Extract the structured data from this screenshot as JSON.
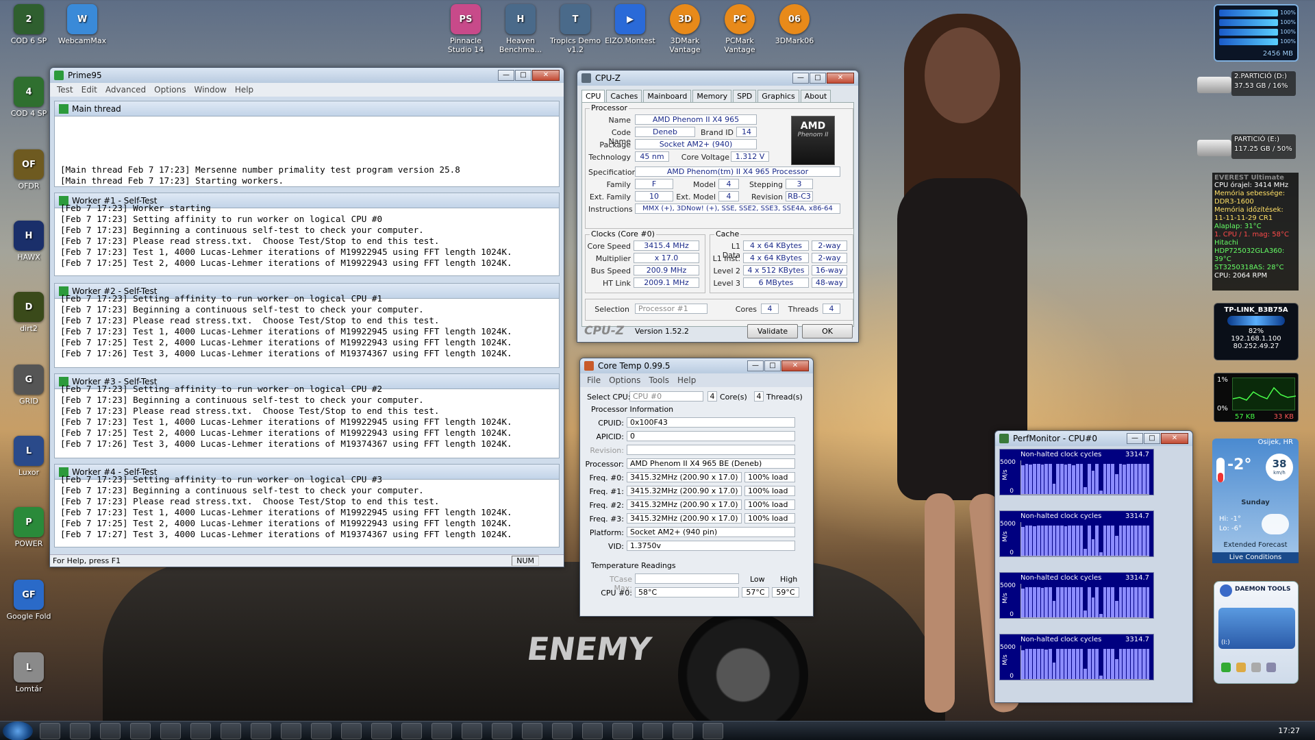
{
  "desktop_icons": [
    {
      "label": "COD 6 SP",
      "color": "#2f5f2f",
      "glyph": "2"
    },
    {
      "label": "COD 4 SP",
      "color": "#2f6f2f",
      "glyph": "4"
    },
    {
      "label": "OFDR",
      "color": "#6e5a20",
      "glyph": "OF"
    },
    {
      "label": "HAWX",
      "color": "#1a2f6a",
      "glyph": "H"
    },
    {
      "label": "dirt2",
      "color": "#3a4a1a",
      "glyph": "D"
    },
    {
      "label": "GRID",
      "color": "#555",
      "glyph": "G"
    },
    {
      "label": "Luxor",
      "color": "#2a4a8a",
      "glyph": "L"
    },
    {
      "label": "POWER",
      "color": "#2a8a3a",
      "glyph": "P"
    },
    {
      "label": "Google Fold",
      "color": "#2a6ac8",
      "glyph": "GF"
    },
    {
      "label": "Lomtár",
      "color": "#8a8a8a",
      "glyph": "L"
    }
  ],
  "top_icons": [
    {
      "label": "WebcamMax",
      "color": "#3a8ad8",
      "glyph": "W"
    },
    {
      "label": "Pinnacle Studio 14",
      "color": "#c84a8a",
      "glyph": "PS"
    },
    {
      "label": "Heaven Benchma...",
      "color": "#4a6a8a",
      "glyph": "H"
    },
    {
      "label": "Tropics Demo v1.2",
      "color": "#4a6a8a",
      "glyph": "T"
    },
    {
      "label": "EIZO.Montest",
      "color": "#2a6ad8",
      "glyph": "▶"
    },
    {
      "label": "3DMark Vantage",
      "color": "#e88a1a",
      "glyph": "3D"
    },
    {
      "label": "PCMark Vantage",
      "color": "#e88a1a",
      "glyph": "PC"
    },
    {
      "label": "3DMark06",
      "color": "#e88a1a",
      "glyph": "06"
    }
  ],
  "prime95": {
    "title": "Prime95",
    "menu": [
      "Test",
      "Edit",
      "Advanced",
      "Options",
      "Window",
      "Help"
    ],
    "panes": [
      {
        "title": "Main thread",
        "lines": [
          "[Main thread Feb 7 17:23] Mersenne number primality test program version 25.8",
          "[Main thread Feb 7 17:23] Starting workers."
        ]
      },
      {
        "title": "Worker #1 - Self-Test",
        "lines": [
          "[Feb 7 17:23] Worker starting",
          "[Feb 7 17:23] Setting affinity to run worker on logical CPU #0",
          "[Feb 7 17:23] Beginning a continuous self-test to check your computer.",
          "[Feb 7 17:23] Please read stress.txt.  Choose Test/Stop to end this test.",
          "[Feb 7 17:23] Test 1, 4000 Lucas-Lehmer iterations of M19922945 using FFT length 1024K.",
          "[Feb 7 17:25] Test 2, 4000 Lucas-Lehmer iterations of M19922943 using FFT length 1024K."
        ]
      },
      {
        "title": "Worker #2 - Self-Test",
        "lines": [
          "[Feb 7 17:23] Setting affinity to run worker on logical CPU #1",
          "[Feb 7 17:23] Beginning a continuous self-test to check your computer.",
          "[Feb 7 17:23] Please read stress.txt.  Choose Test/Stop to end this test.",
          "[Feb 7 17:23] Test 1, 4000 Lucas-Lehmer iterations of M19922945 using FFT length 1024K.",
          "[Feb 7 17:25] Test 2, 4000 Lucas-Lehmer iterations of M19922943 using FFT length 1024K.",
          "[Feb 7 17:26] Test 3, 4000 Lucas-Lehmer iterations of M19374367 using FFT length 1024K."
        ]
      },
      {
        "title": "Worker #3 - Self-Test",
        "lines": [
          "[Feb 7 17:23] Setting affinity to run worker on logical CPU #2",
          "[Feb 7 17:23] Beginning a continuous self-test to check your computer.",
          "[Feb 7 17:23] Please read stress.txt.  Choose Test/Stop to end this test.",
          "[Feb 7 17:23] Test 1, 4000 Lucas-Lehmer iterations of M19922945 using FFT length 1024K.",
          "[Feb 7 17:25] Test 2, 4000 Lucas-Lehmer iterations of M19922943 using FFT length 1024K.",
          "[Feb 7 17:26] Test 3, 4000 Lucas-Lehmer iterations of M19374367 using FFT length 1024K."
        ]
      },
      {
        "title": "Worker #4 - Self-Test",
        "lines": [
          "[Feb 7 17:23] Setting affinity to run worker on logical CPU #3",
          "[Feb 7 17:23] Beginning a continuous self-test to check your computer.",
          "[Feb 7 17:23] Please read stress.txt.  Choose Test/Stop to end this test.",
          "[Feb 7 17:23] Test 1, 4000 Lucas-Lehmer iterations of M19922945 using FFT length 1024K.",
          "[Feb 7 17:25] Test 2, 4000 Lucas-Lehmer iterations of M19922943 using FFT length 1024K.",
          "[Feb 7 17:27] Test 3, 4000 Lucas-Lehmer iterations of M19374367 using FFT length 1024K."
        ]
      }
    ],
    "status": "For Help, press F1",
    "num": "NUM"
  },
  "cpuz": {
    "title": "CPU-Z",
    "tabs": [
      "CPU",
      "Caches",
      "Mainboard",
      "Memory",
      "SPD",
      "Graphics",
      "About"
    ],
    "processor_group": "Processor",
    "name_l": "Name",
    "name": "AMD Phenom II X4 965",
    "codename_l": "Code Name",
    "codename": "Deneb",
    "brandid_l": "Brand ID",
    "brandid": "14",
    "package_l": "Package",
    "package": "Socket AM2+ (940)",
    "tech_l": "Technology",
    "tech": "45 nm",
    "voltage_l": "Core Voltage",
    "voltage": "1.312 V",
    "spec_l": "Specification",
    "spec": "AMD Phenom(tm) II X4 965 Processor",
    "family_l": "Family",
    "family": "F",
    "model_l": "Model",
    "model": "4",
    "stepping_l": "Stepping",
    "stepping": "3",
    "extfam_l": "Ext. Family",
    "extfam": "10",
    "extmod_l": "Ext. Model",
    "extmod": "4",
    "rev_l": "Revision",
    "rev": "RB-C3",
    "instr_l": "Instructions",
    "instr": "MMX (+), 3DNow! (+), SSE, SSE2, SSE3, SSE4A, x86-64",
    "clocks_group": "Clocks (Core #0)",
    "corespeed_l": "Core Speed",
    "corespeed": "3415.4 MHz",
    "mult_l": "Multiplier",
    "mult": "x 17.0",
    "bus_l": "Bus Speed",
    "bus": "200.9 MHz",
    "ht_l": "HT Link",
    "ht": "2009.1 MHz",
    "cache_group": "Cache",
    "l1d_l": "L1 Data",
    "l1d": "4 x 64 KBytes",
    "l1d_w": "2-way",
    "l1i_l": "L1 Inst.",
    "l1i": "4 x 64 KBytes",
    "l1i_w": "2-way",
    "l2_l": "Level 2",
    "l2": "4 x 512 KBytes",
    "l2_w": "16-way",
    "l3_l": "Level 3",
    "l3": "6 MBytes",
    "l3_w": "48-way",
    "sel_l": "Selection",
    "sel": "Processor #1",
    "cores_l": "Cores",
    "cores": "4",
    "threads_l": "Threads",
    "threads": "4",
    "logo_brand": "AMD",
    "logo_sub": "Phenom II",
    "brand": "CPU-Z",
    "version": "Version 1.52.2",
    "validate": "Validate",
    "ok": "OK"
  },
  "coretemp": {
    "title": "Core Temp 0.99.5",
    "menu": [
      "File",
      "Options",
      "Tools",
      "Help"
    ],
    "selcpu_l": "Select CPU:",
    "selcpu": "CPU #0",
    "cores": "4",
    "cores_l": "Core(s)",
    "threads": "4",
    "threads_l": "Thread(s)",
    "procinfo": "Processor Information",
    "rows": [
      {
        "l": "CPUID:",
        "v": "0x100F43",
        "x": ""
      },
      {
        "l": "APICID:",
        "v": "0",
        "x": ""
      },
      {
        "l": "Revision:",
        "v": "",
        "x": ""
      },
      {
        "l": "Processor:",
        "v": "AMD Phenom II X4 965 BE (Deneb)",
        "x": ""
      },
      {
        "l": "Freq. #0:",
        "v": "3415.32MHz (200.90 x 17.0)",
        "x": "100% load"
      },
      {
        "l": "Freq. #1:",
        "v": "3415.32MHz (200.90 x 17.0)",
        "x": "100% load"
      },
      {
        "l": "Freq. #2:",
        "v": "3415.32MHz (200.90 x 17.0)",
        "x": "100% load"
      },
      {
        "l": "Freq. #3:",
        "v": "3415.32MHz (200.90 x 17.0)",
        "x": "100% load"
      },
      {
        "l": "Platform:",
        "v": "Socket AM2+ (940 pin)",
        "x": ""
      },
      {
        "l": "VID:",
        "v": "1.3750v",
        "x": ""
      }
    ],
    "temp_title": "Temperature Readings",
    "tcase_l": "TCase Max:",
    "low_l": "Low",
    "high_l": "High",
    "cpu0_l": "CPU #0:",
    "cpu0": "58°C",
    "low": "57°C",
    "high": "59°C"
  },
  "perfmon": {
    "title": "PerfMonitor - CPU#0",
    "charts": [
      {
        "label": "Non-halted clock cycles",
        "value": "3314.7",
        "ymax": "5000",
        "ymin": "0",
        "unit": "M/s",
        "bars": [
          0.85,
          0.9,
          0.88,
          0.9,
          0.9,
          0.88,
          0.9,
          0.9,
          0.3,
          0.9,
          0.9,
          0.88,
          0.9,
          0.85,
          0.9,
          0.9,
          0.2,
          0.9,
          0.7,
          0.9,
          0.1,
          0.9,
          0.9,
          0.9,
          0.6,
          0.9,
          0.88,
          0.9,
          0.9,
          0.9,
          0.9,
          0.9,
          0.9
        ]
      },
      {
        "label": "Non-halted clock cycles",
        "value": "3314.7",
        "ymax": "5000",
        "ymin": "0",
        "unit": "M/s",
        "bars": [
          0.85,
          0.9,
          0.9,
          0.88,
          0.9,
          0.9,
          0.9,
          0.9,
          0.9,
          0.9,
          0.9,
          0.88,
          0.9,
          0.9,
          0.9,
          0.9,
          0.2,
          0.9,
          0.5,
          0.9,
          0.1,
          0.9,
          0.9,
          0.9,
          0.6,
          0.9,
          0.9,
          0.9,
          0.9,
          0.9,
          0.9,
          0.9,
          0.9
        ]
      },
      {
        "label": "Non-halted clock cycles",
        "value": "3314.7",
        "ymax": "5000",
        "ymin": "0",
        "unit": "M/s",
        "bars": [
          0.85,
          0.9,
          0.9,
          0.9,
          0.9,
          0.88,
          0.9,
          0.9,
          0.5,
          0.9,
          0.9,
          0.9,
          0.9,
          0.9,
          0.9,
          0.9,
          0.2,
          0.9,
          0.6,
          0.9,
          0.1,
          0.9,
          0.9,
          0.9,
          0.5,
          0.9,
          0.9,
          0.9,
          0.9,
          0.9,
          0.9,
          0.9,
          0.9
        ]
      },
      {
        "label": "Non-halted clock cycles",
        "value": "3314.7",
        "ymax": "5000",
        "ymin": "0",
        "unit": "M/s",
        "bars": [
          0.85,
          0.9,
          0.9,
          0.9,
          0.9,
          0.9,
          0.88,
          0.9,
          0.5,
          0.9,
          0.9,
          0.9,
          0.9,
          0.9,
          0.9,
          0.9,
          0.3,
          0.9,
          0.9,
          0.9,
          0.1,
          0.9,
          0.9,
          0.9,
          0.6,
          0.9,
          0.9,
          0.9,
          0.9,
          0.9,
          0.9,
          0.9,
          0.9
        ]
      }
    ]
  },
  "sidebar": {
    "meter_pcts": [
      "100%",
      "100%",
      "100%",
      "100%"
    ],
    "meter_mem": "2456 MB",
    "drive_d_name": "2.PARTICIÓ (D:)",
    "drive_d_info": "37.53 GB / 16%",
    "drive_e_name": "PARTICIÓ (E:)",
    "drive_e_info": "117.25 GB / 50%",
    "everest_title": "EVEREST Ultimate",
    "everest_lines": [
      {
        "t": "CPU órajel: 3414 MHz",
        "c": "#ffffff"
      },
      {
        "t": "Memória sebessége: DDR3-1600",
        "c": "#ffe066"
      },
      {
        "t": "Memória időzítések: 11-11-11-29 CR1",
        "c": "#ffe066"
      },
      {
        "t": "Alaplap: 31°C",
        "c": "#66ff66"
      },
      {
        "t": "1. CPU / 1. mag: 58°C",
        "c": "#ff4a4a"
      },
      {
        "t": "Hitachi HDP725032GLA360: 39°C",
        "c": "#66ff66"
      },
      {
        "t": "ST3250318AS: 28°C",
        "c": "#66ff66"
      },
      {
        "t": "CPU: 2064 RPM",
        "c": "#ffffff"
      }
    ],
    "wifi_name": "TP-LINK_B3B75A",
    "wifi_pct": "82%",
    "wifi_ip1": "192.168.1.100",
    "wifi_ip2": "80.252.49.27",
    "net_top": "1%",
    "net_bot": "0%",
    "net_down": "57 KB",
    "net_up": "33 KB",
    "weather_city": "Osijek, HR",
    "weather_temp": "-2°",
    "weather_wind": "38",
    "weather_wind_unit": "km/h",
    "weather_day": "Sunday",
    "weather_hi": "Hi: -1°",
    "weather_lo": "Lo: -6°",
    "weather_ext": "Extended Forecast",
    "weather_live": "Live Conditions",
    "daemon_title": "DAEMON TOOLS",
    "daemon_drive": "(I:)"
  },
  "taskbar": {
    "clock": "17:27"
  }
}
